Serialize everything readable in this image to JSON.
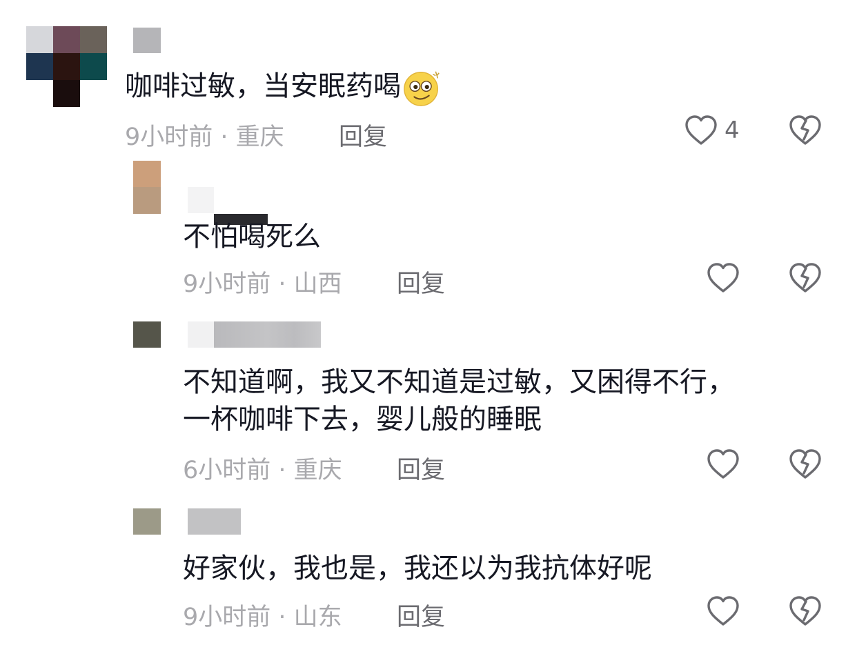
{
  "comments": [
    {
      "text": "咖啡过敏，当安眠药喝",
      "emoji": "dizzy-face-emoji",
      "time_location": "9小时前 · 重庆",
      "reply_label": "回复",
      "likes": "4",
      "avatar_colors": [
        "#d6d7db",
        "#6d4a58",
        "#6a625a",
        "#1e3550",
        "#2b1410",
        "#0d4a4c",
        "#ffffff",
        "#1a0d0d",
        "#ffffff"
      ]
    },
    {
      "text": "不怕喝死么",
      "time_location": "9小时前 · 山西",
      "reply_label": "回复",
      "likes": "",
      "avatar_colors": [
        "#cc9f7b",
        "#b99b7f"
      ]
    },
    {
      "text_line1": "不知道啊，我又不知道是过敏，又困得不行，",
      "text_line2": "一杯咖啡下去，婴儿般的睡眠",
      "time_location": "6小时前 · 重庆",
      "reply_label": "回复",
      "likes": "",
      "avatar_colors": [
        "#55554a"
      ]
    },
    {
      "text": "好家伙，我也是，我还以为我抗体好呢",
      "time_location": "9小时前 · 山东",
      "reply_label": "回复",
      "likes": "",
      "avatar_colors": [
        "#9c9a88"
      ]
    }
  ],
  "icons": {
    "like": "heart-outline-icon",
    "dislike": "broken-heart-icon"
  },
  "colors": {
    "text": "#161823",
    "meta": "#a9a9ad",
    "icon": "#6b6b70"
  }
}
